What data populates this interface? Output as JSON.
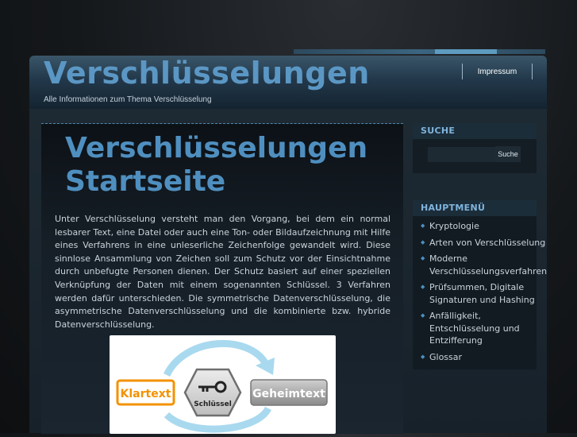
{
  "header": {
    "site_title": "Verschlüsselungen",
    "tagline": "Alle Informationen zum Thema Verschlüsselung",
    "nav": [
      {
        "label": "Impressum"
      }
    ]
  },
  "content": {
    "title_line1": "Verschlüsselungen",
    "title_line2": "Startseite",
    "intro": "Unter Verschlüsselung versteht man den Vorgang, bei dem ein normal lesbarer Text, eine Datei oder auch eine Ton- oder Bildaufzeichnung mit Hilfe eines Verfahrens in eine unleserliche Zeichenfolge gewandelt wird. Diese sinnlose Ansammlung von Zeichen soll zum Schutz vor der Einsichtnahme durch unbefugte Personen dienen. Der Schutz basiert auf einer speziellen Verknüpfung der Daten mit einem sogenannten Schlüssel. 3 Verfahren werden dafür unterschieden. Die symmetrische Datenverschlüsselung, die asymmetrische Datenverschlüsselung und die kombinierte bzw. hybride Datenverschlüsselung.",
    "diagram": {
      "left_label": "Klartext",
      "center_label": "Schlüssel",
      "right_label": "Geheimtext",
      "icon": "key-icon"
    }
  },
  "sidebar": {
    "search": {
      "title": "SUCHE",
      "placeholder": "",
      "button_label": "Suche"
    },
    "menu": {
      "title": "HAUPTMENÜ",
      "items": [
        {
          "label": "Kryptologie"
        },
        {
          "label": "Arten von Verschlüsselung"
        },
        {
          "label": "Moderne\nVerschlüsselungsverfahren"
        },
        {
          "label": "Prüfsummen, Digitale\nSignaturen und Hashing"
        },
        {
          "label": "Anfälligkeit,\nEntschlüsselung und\nEntzifferung"
        },
        {
          "label": "Glossar"
        }
      ]
    }
  },
  "colors": {
    "accent": "#4f8fc0",
    "background": "#111417",
    "text": "#c9d3da",
    "diagram_orange": "#f39200",
    "diagram_arrow": "#a9d9ef"
  }
}
